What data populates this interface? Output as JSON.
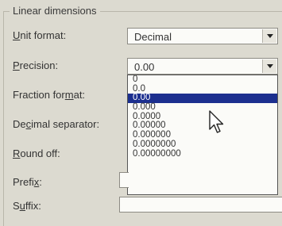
{
  "group_title": "Linear dimensions",
  "fields": {
    "unit_format": {
      "label_first": "U",
      "label_rest": "nit format:",
      "value": "Decimal"
    },
    "precision": {
      "label_first": "P",
      "label_rest": "recision:",
      "value": "0.00"
    },
    "fraction_format": {
      "label_pre": "Fraction for",
      "label_ul": "m",
      "label_post": "at:"
    },
    "decimal_separator": {
      "label_pre": "De",
      "label_ul": "c",
      "label_post": "imal separator:"
    },
    "round_off": {
      "label_first": "R",
      "label_rest": "ound off:"
    },
    "prefix": {
      "label_pre": "Prefi",
      "label_ul": "x",
      "label_post": ":"
    },
    "suffix": {
      "label_pre": "S",
      "label_ul": "u",
      "label_post": "ffix:"
    }
  },
  "precision_options": [
    "0",
    "0.0",
    "0.00",
    "0.000",
    "0.0000",
    "0.00000",
    "0.000000",
    "0.0000000",
    "0.00000000"
  ],
  "selected_index": 2,
  "colors": {
    "selection": "#1c2f8f",
    "background": "#dcdad0"
  }
}
